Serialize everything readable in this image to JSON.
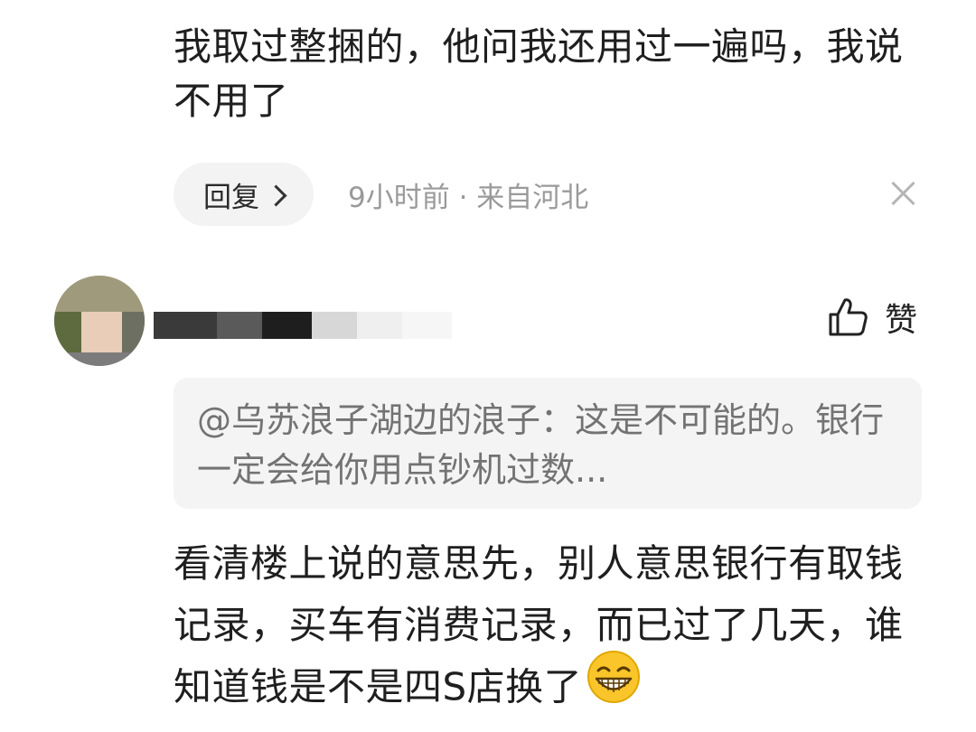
{
  "comment1": {
    "text": "我取过整捆的，他问我还用过一遍吗，我说不用了",
    "reply_label": "回复",
    "meta": "9小时前 · 来自河北"
  },
  "comment2": {
    "like_label": "赞",
    "quote": "@乌苏浪子湖边的浪子：这是不可能的。银行一定会给你用点钞机过数...",
    "text": "看清楼上说的意思先，别人意思银行有取钱记录，买车有消费记录，而已过了几天，谁知道钱是不是四S店换了",
    "emoji": "grinning-face-icon"
  },
  "colors": {
    "meta_gray": "#9a9a9a",
    "quote_bg": "#f4f4f4",
    "reply_bg": "#f3f3f3",
    "emoji_yellow": "#f9c52a"
  }
}
